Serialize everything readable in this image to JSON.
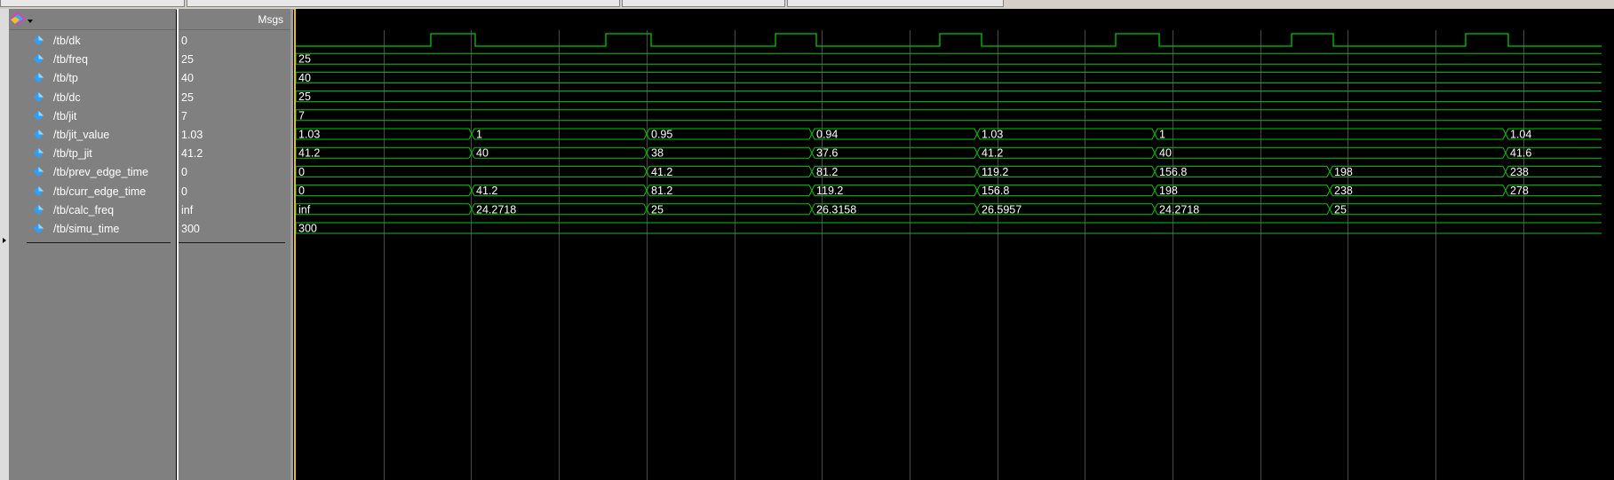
{
  "header": {
    "msgs_label": "Msgs"
  },
  "icons": {
    "add_wave": "add-wave-icon",
    "signal": "signal-diamond-icon"
  },
  "colors": {
    "wave": "#00c800",
    "grid": "#3a4a3a",
    "cursor": "#e8c200",
    "signal_icon": "#2aa0ff",
    "text": "#ffffff"
  },
  "signals": [
    {
      "name": "/tb/dk",
      "value": "0"
    },
    {
      "name": "/tb/freq",
      "value": "25"
    },
    {
      "name": "/tb/tp",
      "value": "40"
    },
    {
      "name": "/tb/dc",
      "value": "25"
    },
    {
      "name": "/tb/jit",
      "value": "7"
    },
    {
      "name": "/tb/jit_value",
      "value": "1.03"
    },
    {
      "name": "/tb/tp_jit",
      "value": "41.2"
    },
    {
      "name": "/tb/prev_edge_time",
      "value": "0"
    },
    {
      "name": "/tb/curr_edge_time",
      "value": "0"
    },
    {
      "name": "/tb/calc_freq",
      "value": "inf"
    },
    {
      "name": "/tb/simu_time",
      "value": "300"
    }
  ],
  "waveform": {
    "clock_high_intervals": [
      [
        152,
        202
      ],
      [
        349,
        400
      ],
      [
        540,
        586
      ],
      [
        725,
        772
      ],
      [
        923,
        972
      ],
      [
        1121,
        1168
      ],
      [
        1317,
        1365
      ]
    ],
    "bus_rows": [
      {
        "segments": [
          {
            "start": 0,
            "label": "25"
          }
        ]
      },
      {
        "segments": [
          {
            "start": 0,
            "label": "40"
          }
        ]
      },
      {
        "segments": [
          {
            "start": 0,
            "label": "25"
          }
        ]
      },
      {
        "segments": [
          {
            "start": 0,
            "label": "7"
          }
        ]
      },
      {
        "segments": [
          {
            "start": 0,
            "label": "1.03"
          },
          {
            "start": 198,
            "label": "1"
          },
          {
            "start": 395,
            "label": "0.95"
          },
          {
            "start": 581,
            "label": "0.94"
          },
          {
            "start": 767,
            "label": "1.03"
          },
          {
            "start": 967,
            "label": "1"
          },
          {
            "start": 1362,
            "label": "1.04"
          }
        ]
      },
      {
        "segments": [
          {
            "start": 0,
            "label": "41.2"
          },
          {
            "start": 198,
            "label": "40"
          },
          {
            "start": 395,
            "label": "38"
          },
          {
            "start": 581,
            "label": "37.6"
          },
          {
            "start": 767,
            "label": "41.2"
          },
          {
            "start": 967,
            "label": "40"
          },
          {
            "start": 1362,
            "label": "41.6"
          }
        ]
      },
      {
        "segments": [
          {
            "start": 0,
            "label": "0"
          },
          {
            "start": 395,
            "label": "41.2"
          },
          {
            "start": 581,
            "label": "81.2"
          },
          {
            "start": 767,
            "label": "119.2"
          },
          {
            "start": 967,
            "label": "156.8"
          },
          {
            "start": 1164,
            "label": "198"
          },
          {
            "start": 1362,
            "label": "238"
          }
        ]
      },
      {
        "segments": [
          {
            "start": 0,
            "label": "0"
          },
          {
            "start": 198,
            "label": "41.2"
          },
          {
            "start": 395,
            "label": "81.2"
          },
          {
            "start": 581,
            "label": "119.2"
          },
          {
            "start": 767,
            "label": "156.8"
          },
          {
            "start": 967,
            "label": "198"
          },
          {
            "start": 1164,
            "label": "238"
          },
          {
            "start": 1362,
            "label": "278"
          }
        ]
      },
      {
        "segments": [
          {
            "start": 0,
            "label": "inf"
          },
          {
            "start": 198,
            "label": "24.2718"
          },
          {
            "start": 395,
            "label": "25"
          },
          {
            "start": 581,
            "label": "26.3158"
          },
          {
            "start": 767,
            "label": "26.5957"
          },
          {
            "start": 967,
            "label": "24.2718"
          },
          {
            "start": 1164,
            "label": "25"
          }
        ]
      },
      {
        "segments": [
          {
            "start": 0,
            "label": "300"
          }
        ]
      }
    ]
  }
}
